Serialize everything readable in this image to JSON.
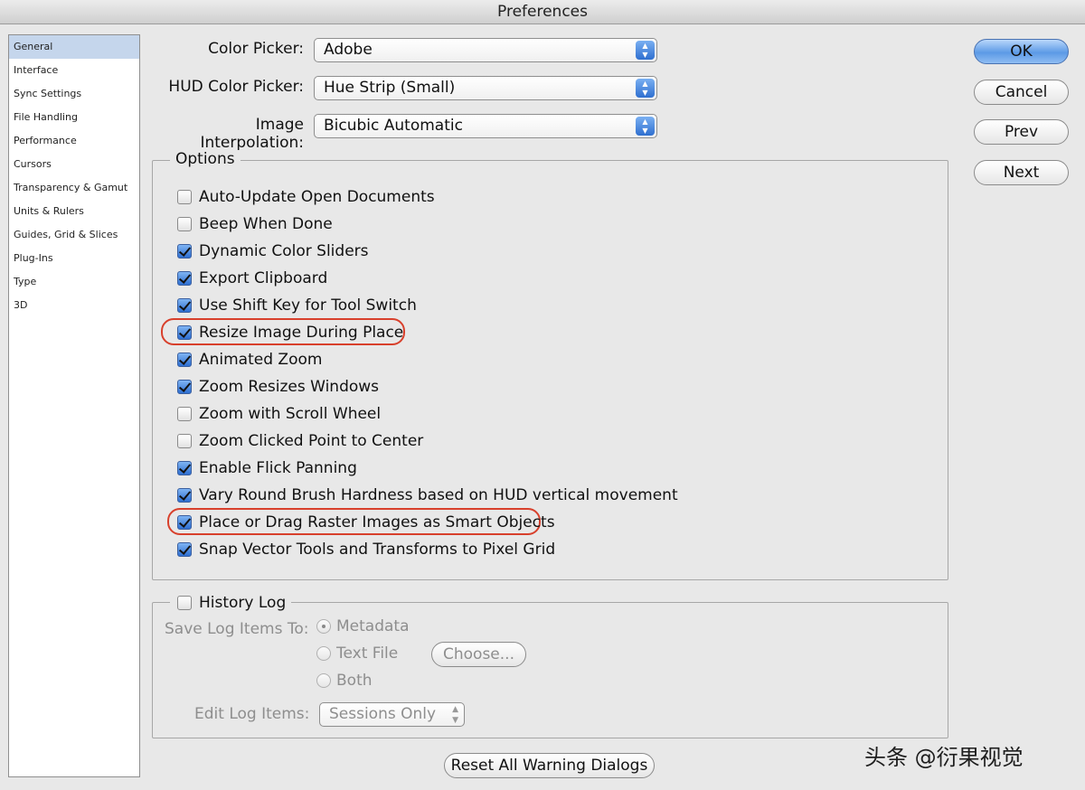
{
  "window": {
    "title": "Preferences"
  },
  "sidebar": {
    "items": [
      {
        "label": "General",
        "selected": true
      },
      {
        "label": "Interface"
      },
      {
        "label": "Sync Settings"
      },
      {
        "label": "File Handling"
      },
      {
        "label": "Performance"
      },
      {
        "label": "Cursors"
      },
      {
        "label": "Transparency & Gamut"
      },
      {
        "label": "Units & Rulers"
      },
      {
        "label": "Guides, Grid & Slices"
      },
      {
        "label": "Plug-Ins"
      },
      {
        "label": "Type"
      },
      {
        "label": "3D"
      }
    ]
  },
  "settings": {
    "color_picker": {
      "label": "Color Picker:",
      "value": "Adobe"
    },
    "hud_color_picker": {
      "label": "HUD Color Picker:",
      "value": "Hue Strip (Small)"
    },
    "image_interpolation": {
      "label": "Image Interpolation:",
      "value": "Bicubic Automatic"
    }
  },
  "options": {
    "title": "Options",
    "items": [
      {
        "label": "Auto-Update Open Documents",
        "checked": false
      },
      {
        "label": "Beep When Done",
        "checked": false
      },
      {
        "label": "Dynamic Color Sliders",
        "checked": true
      },
      {
        "label": "Export Clipboard",
        "checked": true
      },
      {
        "label": "Use Shift Key for Tool Switch",
        "checked": true
      },
      {
        "label": "Resize Image During Place",
        "checked": true,
        "highlighted": true
      },
      {
        "label": "Animated Zoom",
        "checked": true
      },
      {
        "label": "Zoom Resizes Windows",
        "checked": true
      },
      {
        "label": "Zoom with Scroll Wheel",
        "checked": false
      },
      {
        "label": "Zoom Clicked Point to Center",
        "checked": false
      },
      {
        "label": "Enable Flick Panning",
        "checked": true
      },
      {
        "label": "Vary Round Brush Hardness based on HUD vertical movement",
        "checked": true
      },
      {
        "label": "Place or Drag Raster Images as Smart Objects",
        "checked": true,
        "highlighted": true
      },
      {
        "label": "Snap Vector Tools and Transforms to Pixel Grid",
        "checked": true
      }
    ]
  },
  "history_log": {
    "title": "History Log",
    "enabled": false,
    "save_to_label": "Save Log Items To:",
    "radios": [
      {
        "label": "Metadata",
        "selected": true
      },
      {
        "label": "Text File",
        "selected": false
      },
      {
        "label": "Both",
        "selected": false
      }
    ],
    "choose_label": "Choose...",
    "edit_label": "Edit Log Items:",
    "edit_value": "Sessions Only"
  },
  "buttons": {
    "ok": "OK",
    "cancel": "Cancel",
    "prev": "Prev",
    "next": "Next",
    "reset_warnings": "Reset All Warning Dialogs"
  },
  "watermark": "头条 @衍果视觉",
  "colors": {
    "accent": "#3a7bd5",
    "highlight_ring": "#d8402c",
    "selection": "#c5d6ec"
  }
}
